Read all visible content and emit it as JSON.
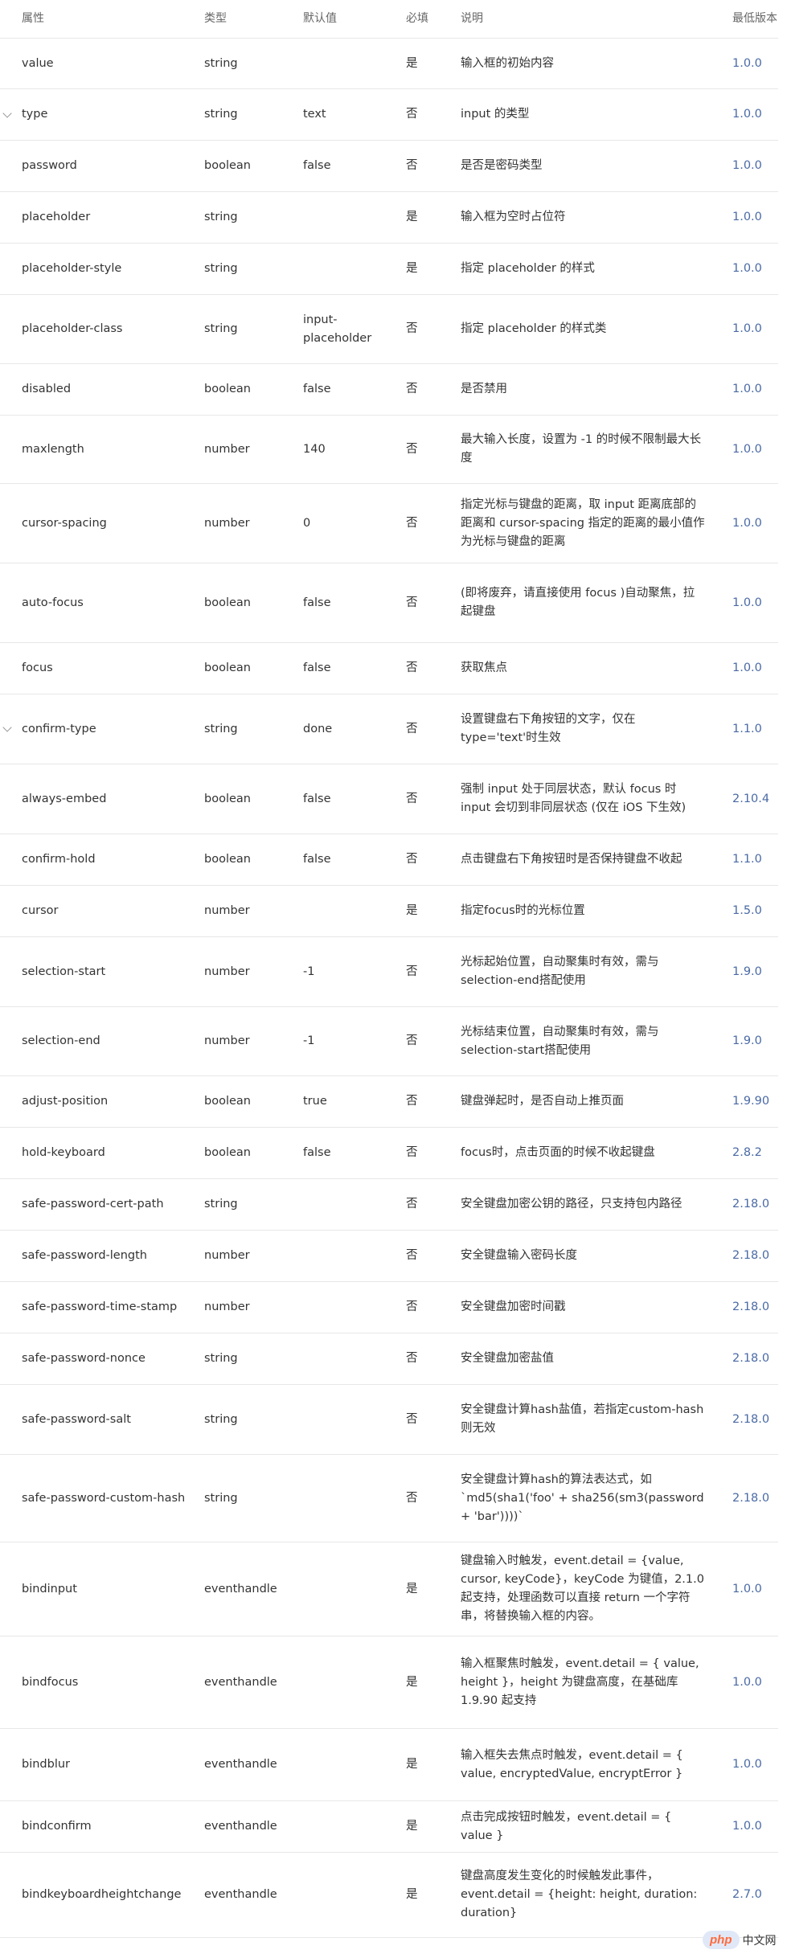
{
  "table": {
    "headers": {
      "name": "属性",
      "type": "类型",
      "default": "默认值",
      "required": "必填",
      "desc": "说明",
      "version": "最低版本"
    },
    "rows": [
      {
        "name": "value",
        "type": "string",
        "default": "",
        "required": "是",
        "desc": "输入框的初始内容",
        "version": "1.0.0",
        "expandable": false
      },
      {
        "name": "type",
        "type": "string",
        "default": "text",
        "required": "否",
        "desc": "input 的类型",
        "version": "1.0.0",
        "expandable": true
      },
      {
        "name": "password",
        "type": "boolean",
        "default": "false",
        "required": "否",
        "desc": "是否是密码类型",
        "version": "1.0.0",
        "expandable": false
      },
      {
        "name": "placeholder",
        "type": "string",
        "default": "",
        "required": "是",
        "desc": "输入框为空时占位符",
        "version": "1.0.0",
        "expandable": false
      },
      {
        "name": "placeholder-style",
        "type": "string",
        "default": "",
        "required": "是",
        "desc": "指定 placeholder 的样式",
        "version": "1.0.0",
        "expandable": false
      },
      {
        "name": "placeholder-class",
        "type": "string",
        "default": "input-placeholder",
        "required": "否",
        "desc": "指定 placeholder 的样式类",
        "version": "1.0.0",
        "expandable": false
      },
      {
        "name": "disabled",
        "type": "boolean",
        "default": "false",
        "required": "否",
        "desc": "是否禁用",
        "version": "1.0.0",
        "expandable": false
      },
      {
        "name": "maxlength",
        "type": "number",
        "default": "140",
        "required": "否",
        "desc": "最大输入长度，设置为 -1 的时候不限制最大长度",
        "version": "1.0.0",
        "expandable": false
      },
      {
        "name": "cursor-spacing",
        "type": "number",
        "default": "0",
        "required": "否",
        "desc": "指定光标与键盘的距离，取 input 距离底部的距离和 cursor-spacing 指定的距离的最小值作为光标与键盘的距离",
        "version": "1.0.0",
        "expandable": false
      },
      {
        "name": "auto-focus",
        "type": "boolean",
        "default": "false",
        "required": "否",
        "desc": "(即将废弃，请直接使用 focus )自动聚焦，拉起键盘",
        "version": "1.0.0",
        "expandable": false
      },
      {
        "name": "focus",
        "type": "boolean",
        "default": "false",
        "required": "否",
        "desc": "获取焦点",
        "version": "1.0.0",
        "expandable": false
      },
      {
        "name": "confirm-type",
        "type": "string",
        "default": "done",
        "required": "否",
        "desc": "设置键盘右下角按钮的文字，仅在type='text'时生效",
        "version": "1.1.0",
        "expandable": true
      },
      {
        "name": "always-embed",
        "type": "boolean",
        "default": "false",
        "required": "否",
        "desc": "强制 input 处于同层状态，默认 focus 时 input 会切到非同层状态 (仅在 iOS 下生效)",
        "version": "2.10.4",
        "expandable": false
      },
      {
        "name": "confirm-hold",
        "type": "boolean",
        "default": "false",
        "required": "否",
        "desc": "点击键盘右下角按钮时是否保持键盘不收起",
        "version": "1.1.0",
        "expandable": false
      },
      {
        "name": "cursor",
        "type": "number",
        "default": "",
        "required": "是",
        "desc": "指定focus时的光标位置",
        "version": "1.5.0",
        "expandable": false
      },
      {
        "name": "selection-start",
        "type": "number",
        "default": "-1",
        "required": "否",
        "desc": "光标起始位置，自动聚集时有效，需与selection-end搭配使用",
        "version": "1.9.0",
        "expandable": false
      },
      {
        "name": "selection-end",
        "type": "number",
        "default": "-1",
        "required": "否",
        "desc": "光标结束位置，自动聚集时有效，需与selection-start搭配使用",
        "version": "1.9.0",
        "expandable": false
      },
      {
        "name": "adjust-position",
        "type": "boolean",
        "default": "true",
        "required": "否",
        "desc": "键盘弹起时，是否自动上推页面",
        "version": "1.9.90",
        "expandable": false
      },
      {
        "name": "hold-keyboard",
        "type": "boolean",
        "default": "false",
        "required": "否",
        "desc": "focus时，点击页面的时候不收起键盘",
        "version": "2.8.2",
        "expandable": false
      },
      {
        "name": "safe-password-cert-path",
        "type": "string",
        "default": "",
        "required": "否",
        "desc": "安全键盘加密公钥的路径，只支持包内路径",
        "version": "2.18.0",
        "expandable": false
      },
      {
        "name": "safe-password-length",
        "type": "number",
        "default": "",
        "required": "否",
        "desc": "安全键盘输入密码长度",
        "version": "2.18.0",
        "expandable": false
      },
      {
        "name": "safe-password-time-stamp",
        "type": "number",
        "default": "",
        "required": "否",
        "desc": "安全键盘加密时间戳",
        "version": "2.18.0",
        "expandable": false
      },
      {
        "name": "safe-password-nonce",
        "type": "string",
        "default": "",
        "required": "否",
        "desc": "安全键盘加密盐值",
        "version": "2.18.0",
        "expandable": false
      },
      {
        "name": "safe-password-salt",
        "type": "string",
        "default": "",
        "required": "否",
        "desc": "安全键盘计算hash盐值，若指定custom-hash 则无效",
        "version": "2.18.0",
        "expandable": false
      },
      {
        "name": "safe-password-custom-hash",
        "type": "string",
        "default": "",
        "required": "否",
        "desc": "安全键盘计算hash的算法表达式，如 `md5(sha1('foo' + sha256(sm3(password + 'bar'))))`",
        "version": "2.18.0",
        "expandable": false
      },
      {
        "name": "bindinput",
        "type": "eventhandle",
        "default": "",
        "required": "是",
        "desc": "键盘输入时触发，event.detail = {value, cursor, keyCode}，keyCode 为键值，2.1.0 起支持，处理函数可以直接 return 一个字符串，将替换输入框的内容。",
        "version": "1.0.0",
        "expandable": false
      },
      {
        "name": "bindfocus",
        "type": "eventhandle",
        "default": "",
        "required": "是",
        "desc": "输入框聚焦时触发，event.detail = { value, height }，height 为键盘高度，在基础库 1.9.90 起支持",
        "version": "1.0.0",
        "expandable": false
      },
      {
        "name": "bindblur",
        "type": "eventhandle",
        "default": "",
        "required": "是",
        "desc": "输入框失去焦点时触发，event.detail = { value, encryptedValue, encryptError }",
        "version": "1.0.0",
        "expandable": false
      },
      {
        "name": "bindconfirm",
        "type": "eventhandle",
        "default": "",
        "required": "是",
        "desc": "点击完成按钮时触发，event.detail = { value }",
        "version": "1.0.0",
        "expandable": false
      },
      {
        "name": "bindkeyboardheightchange",
        "type": "eventhandle",
        "default": "",
        "required": "是",
        "desc": "键盘高度发生变化的时候触发此事件，event.detail = {height: height, duration: duration}",
        "version": "2.7.0",
        "expandable": false
      }
    ]
  },
  "watermark": {
    "logo_text": "php",
    "site_text": "中文网"
  },
  "colors": {
    "version_link": "#4a6aa5",
    "border": "#e7e7e7"
  }
}
